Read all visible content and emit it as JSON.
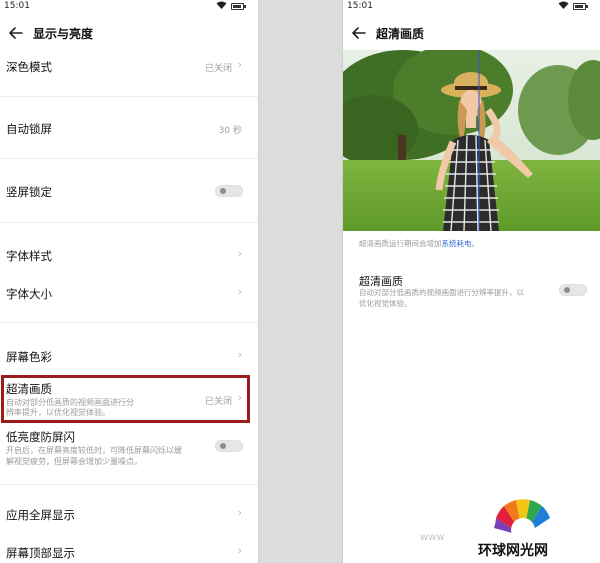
{
  "left": {
    "status_time": "15:01",
    "title": "显示与亮度",
    "rows": {
      "dark_mode": {
        "title": "深色模式",
        "value": "已关闭"
      },
      "auto_lock": {
        "title": "自动锁屏",
        "value": "30 秒"
      },
      "orientation_lock": {
        "title": "竖屏锁定"
      },
      "font_style": {
        "title": "字体样式"
      },
      "font_size": {
        "title": "字体大小"
      },
      "screen_color": {
        "title": "屏幕色彩"
      },
      "hd_quality": {
        "title": "超清画质",
        "subtitle_line1": "自动对部分低画质的视频画面进行分",
        "subtitle_line2": "辨率提升，以优化视觉体验。",
        "value": "已关闭"
      },
      "low_brightness_flicker": {
        "title": "低亮度防屏闪",
        "subtitle_line1": "开启后，在屏幕亮度较低时，可降低屏幕闪烁以缓",
        "subtitle_line2": "解视觉疲劳，但屏幕会增加少量噪点。"
      },
      "app_fullscreen": {
        "title": "应用全屏显示"
      },
      "top_display": {
        "title": "屏幕顶部显示"
      }
    }
  },
  "right": {
    "status_time": "15:01",
    "title": "超清画质",
    "caption_text": "超清画质运行期间会增加",
    "caption_link": "系统耗电",
    "caption_end": "。",
    "setting_title": "超清画质",
    "setting_sub_line1": "自动对部分低画质的视频画面进行分辨率提升，以",
    "setting_sub_line2": "优化视觉体验。"
  },
  "watermark": {
    "letter": "M",
    "www": "www",
    "site_name": "环球网光网"
  },
  "colors": {
    "highlight": "#9c1b1d",
    "link": "#3a6cd9"
  }
}
